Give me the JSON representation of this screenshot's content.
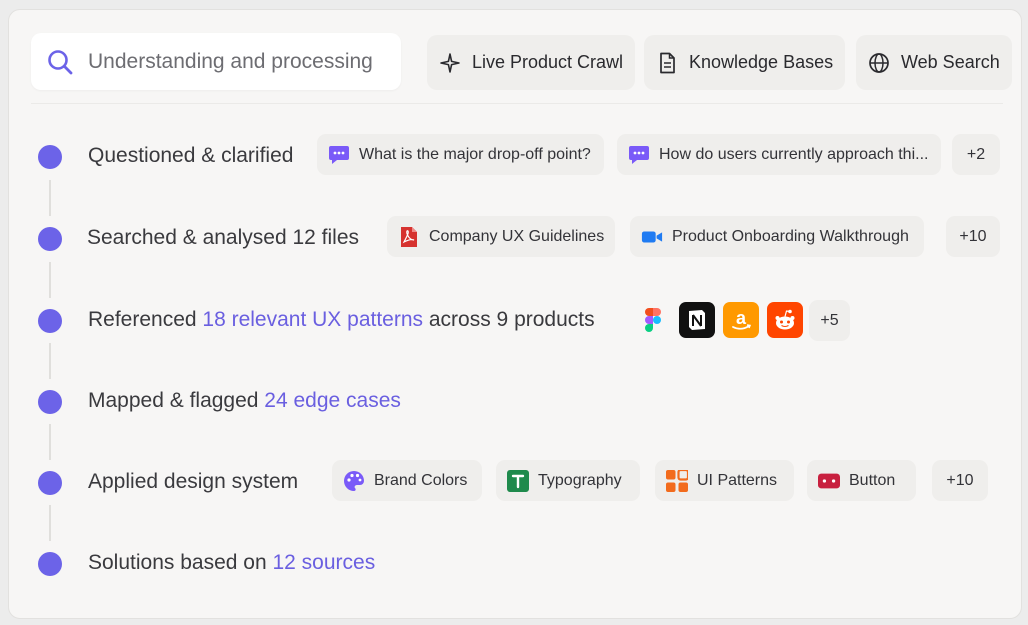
{
  "search": {
    "text": "Understanding and processing"
  },
  "sources": [
    {
      "label": "Live Product Crawl",
      "icon": "sparkle-icon"
    },
    {
      "label": "Knowledge Bases",
      "icon": "document-icon"
    },
    {
      "label": "Web Search",
      "icon": "globe-icon"
    }
  ],
  "steps": {
    "s1": {
      "label": "Questioned & clarified",
      "chips": [
        "What is the major drop-off point?",
        "How do users currently approach thi..."
      ],
      "more": "+2"
    },
    "s2": {
      "label": "Searched & analysed 12 files",
      "chips": [
        "Company UX Guidelines",
        "Product Onboarding Walkthrough"
      ],
      "more": "+10"
    },
    "s3": {
      "pre": "Referenced ",
      "hl": "18 relevant UX patterns",
      "post": " across 9 products",
      "apps": [
        "figma-icon",
        "notion-icon",
        "amazon-icon",
        "reddit-icon"
      ],
      "more": "+5"
    },
    "s4": {
      "pre": "Mapped & flagged ",
      "hl": "24 edge cases"
    },
    "s5": {
      "label": "Applied design system",
      "chips": [
        "Brand Colors",
        "Typography",
        "UI Patterns",
        "Button"
      ],
      "more": "+10"
    },
    "s6": {
      "pre": "Solutions based on ",
      "hl": "12 sources"
    }
  },
  "colors": {
    "accent": "#6c63e8",
    "highlight_text": "#6a5fe0",
    "chat_icon": "#7a5af8",
    "pdf_red": "#d6322f",
    "video_blue": "#1f7bf2",
    "typography_green": "#1f8a4c",
    "ui_patterns_orange": "#f26b1d",
    "button_red": "#c8203f"
  }
}
